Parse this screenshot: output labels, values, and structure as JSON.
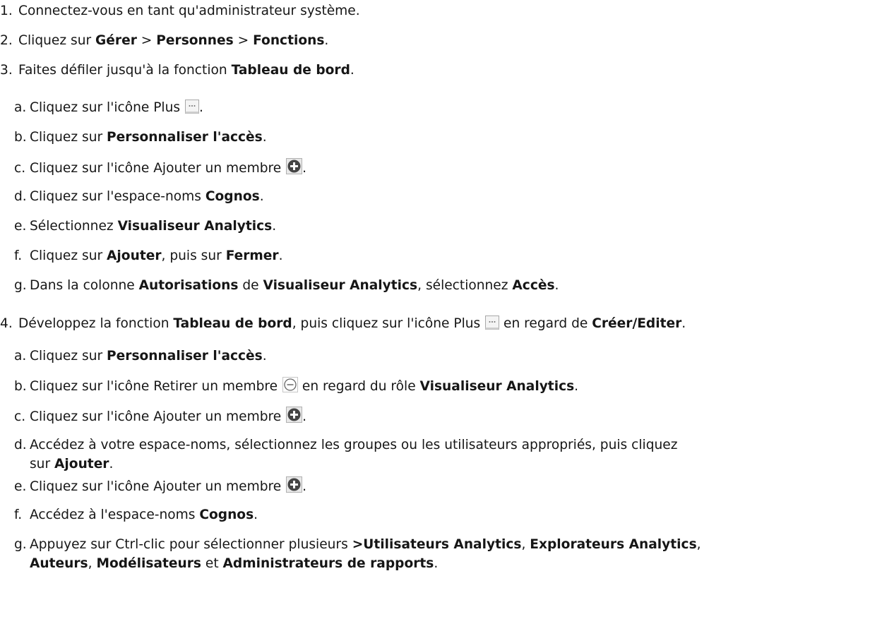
{
  "steps": [
    {
      "num": "1.",
      "text": [
        {
          "t": "Connectez-vous en tant qu'administrateur système."
        }
      ]
    },
    {
      "num": "2.",
      "text": [
        {
          "t": "Cliquez sur "
        },
        {
          "b": "Gérer"
        },
        {
          "t": " > "
        },
        {
          "b": "Personnes"
        },
        {
          "t": " > "
        },
        {
          "b": "Fonctions"
        },
        {
          "t": "."
        }
      ]
    },
    {
      "num": "3.",
      "text": [
        {
          "t": "Faites défiler jusqu'à la fonction "
        },
        {
          "b": "Tableau de bord"
        },
        {
          "t": "."
        }
      ],
      "sub": [
        {
          "l": "a.",
          "text": [
            {
              "t": "Cliquez sur l'icône Plus "
            },
            {
              "i": "more-icon"
            },
            {
              "t": "."
            }
          ]
        },
        {
          "l": "b.",
          "text": [
            {
              "t": "Cliquez sur "
            },
            {
              "b": "Personnaliser l'accès"
            },
            {
              "t": "."
            }
          ]
        },
        {
          "l": "c.",
          "text": [
            {
              "t": "Cliquez sur l'icône Ajouter un membre "
            },
            {
              "i": "add-member-icon"
            },
            {
              "t": "."
            }
          ]
        },
        {
          "l": "d.",
          "text": [
            {
              "t": "Cliquez sur l'espace-noms "
            },
            {
              "b": "Cognos"
            },
            {
              "t": "."
            }
          ]
        },
        {
          "l": "e.",
          "text": [
            {
              "t": "Sélectionnez "
            },
            {
              "b": "Visualiseur Analytics"
            },
            {
              "t": "."
            }
          ]
        },
        {
          "l": "f.",
          "text": [
            {
              "t": "Cliquez sur "
            },
            {
              "b": "Ajouter"
            },
            {
              "t": ", puis sur "
            },
            {
              "b": "Fermer"
            },
            {
              "t": "."
            }
          ]
        },
        {
          "l": "g.",
          "text": [
            {
              "t": "Dans la colonne "
            },
            {
              "b": "Autorisations"
            },
            {
              "t": " de "
            },
            {
              "b": "Visualiseur Analytics"
            },
            {
              "t": ", sélectionnez "
            },
            {
              "b": "Accès"
            },
            {
              "t": "."
            }
          ]
        }
      ]
    },
    {
      "num": "4.",
      "text": [
        {
          "t": "Développez la fonction "
        },
        {
          "b": "Tableau de bord"
        },
        {
          "t": ", puis cliquez sur l'icône Plus "
        },
        {
          "i": "more-icon"
        },
        {
          "t": " en regard de "
        },
        {
          "b": "Créer/Editer"
        },
        {
          "t": "."
        }
      ],
      "sub": [
        {
          "l": "a.",
          "text": [
            {
              "t": "Cliquez sur "
            },
            {
              "b": "Personnaliser l'accès"
            },
            {
              "t": "."
            }
          ]
        },
        {
          "l": "b.",
          "text": [
            {
              "t": "Cliquez sur l'icône Retirer un membre "
            },
            {
              "i": "remove-member-icon"
            },
            {
              "t": " en regard du rôle "
            },
            {
              "b": "Visualiseur Analytics"
            },
            {
              "t": "."
            }
          ]
        },
        {
          "l": "c.",
          "text": [
            {
              "t": "Cliquez sur l'icône Ajouter un membre "
            },
            {
              "i": "add-member-icon"
            },
            {
              "t": "."
            }
          ]
        },
        {
          "l": "d.",
          "text": [
            {
              "t": "Accédez à votre espace-noms, sélectionnez les groupes ou les utilisateurs appropriés, puis cliquez"
            }
          ],
          "cont": [
            {
              "t": "sur "
            },
            {
              "b": "Ajouter"
            },
            {
              "t": "."
            }
          ]
        },
        {
          "l": "e.",
          "text": [
            {
              "t": "Cliquez sur l'icône Ajouter un membre "
            },
            {
              "i": "add-member-icon"
            },
            {
              "t": "."
            }
          ]
        },
        {
          "l": "f.",
          "text": [
            {
              "t": "Accédez à l'espace-noms "
            },
            {
              "b": "Cognos"
            },
            {
              "t": "."
            }
          ]
        },
        {
          "l": "g.",
          "text": [
            {
              "t": "Appuyez sur Ctrl-clic pour sélectionner plusieurs "
            },
            {
              "b": ">Utilisateurs Analytics"
            },
            {
              "t": ", "
            },
            {
              "b": "Explorateurs Analytics"
            },
            {
              "t": ","
            }
          ],
          "cont": [
            {
              "b": "Auteurs"
            },
            {
              "t": ", "
            },
            {
              "b": "Modélisateurs"
            },
            {
              "t": " et "
            },
            {
              "b": "Administrateurs de rapports"
            },
            {
              "t": "."
            }
          ]
        }
      ]
    }
  ]
}
